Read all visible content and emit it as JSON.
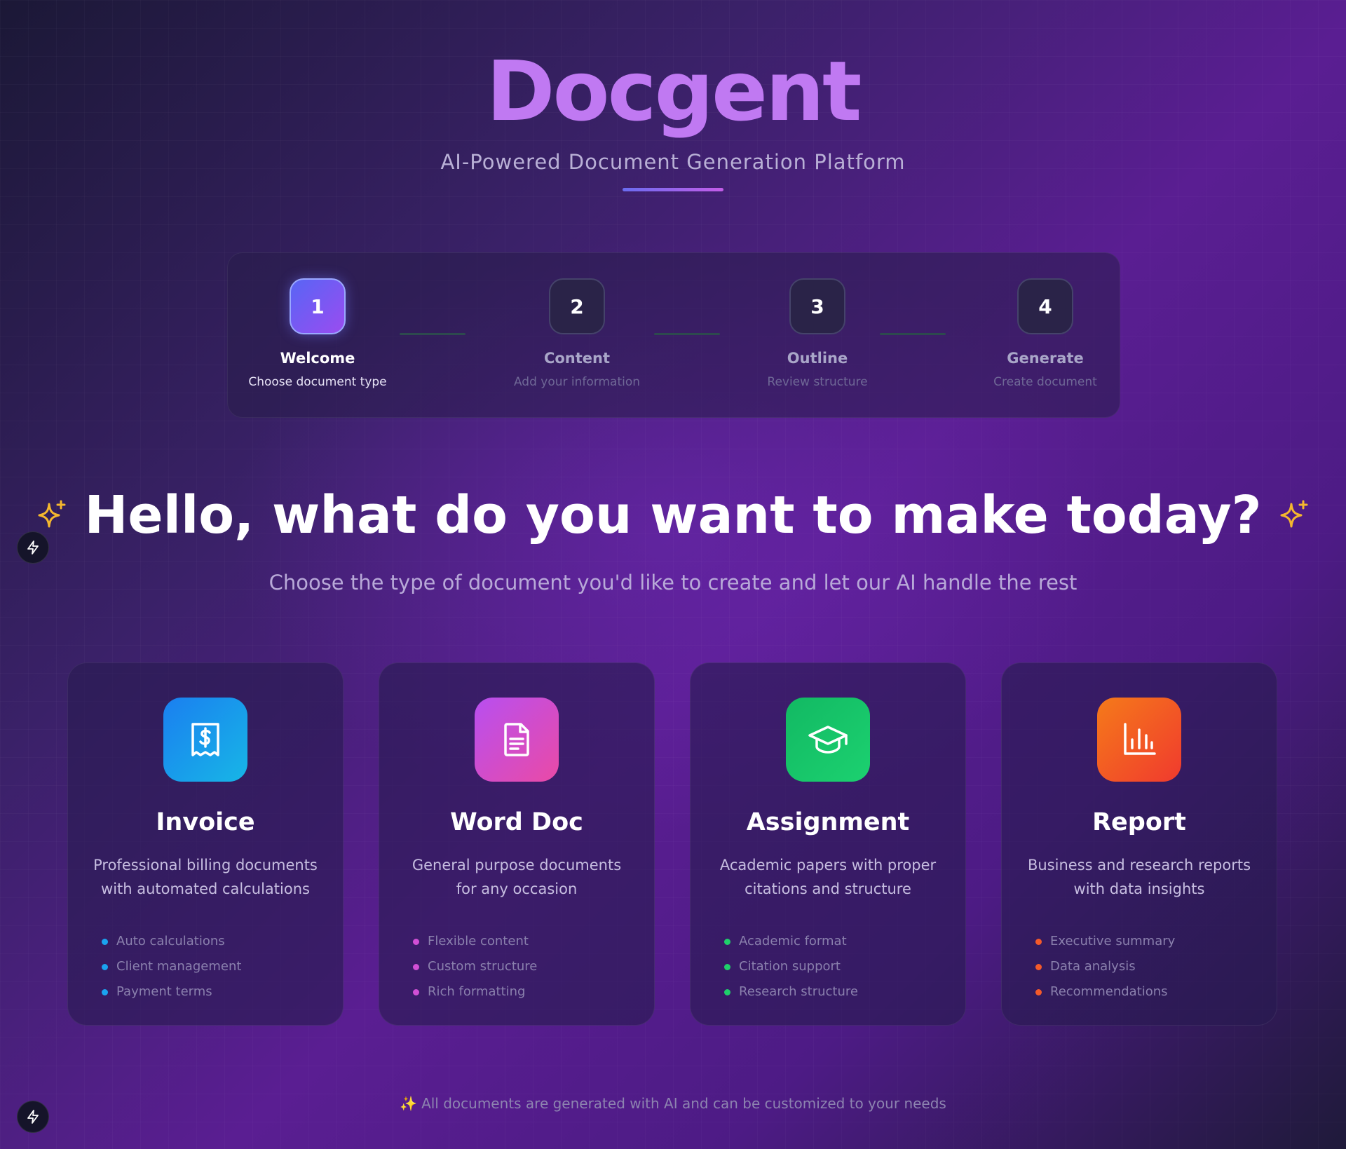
{
  "app": {
    "brand": "Docgent",
    "tagline": "AI-Powered Document Generation Platform"
  },
  "steps": [
    {
      "number": "1",
      "title": "Welcome",
      "subtitle": "Choose document type",
      "active": true
    },
    {
      "number": "2",
      "title": "Content",
      "subtitle": "Add your information",
      "active": false
    },
    {
      "number": "3",
      "title": "Outline",
      "subtitle": "Review structure",
      "active": false
    },
    {
      "number": "4",
      "title": "Generate",
      "subtitle": "Create document",
      "active": false
    }
  ],
  "hero": {
    "title": "Hello, what do you want to make today?",
    "subtitle": "Choose the type of document you'd like to create and let our AI handle the rest"
  },
  "cards": [
    {
      "icon": "receipt-dollar-icon",
      "accent": "#1aa3f0",
      "gradient": [
        "#1a7ff0",
        "#17b6e6"
      ],
      "title": "Invoice",
      "description": "Professional billing documents with automated calculations",
      "features": [
        "Auto calculations",
        "Client management",
        "Payment terms"
      ]
    },
    {
      "icon": "document-icon",
      "accent": "#d24fd6",
      "gradient": [
        "#b84ff0",
        "#ea4aa6"
      ],
      "title": "Word Doc",
      "description": "General purpose documents for any occasion",
      "features": [
        "Flexible content",
        "Custom structure",
        "Rich formatting"
      ]
    },
    {
      "icon": "graduation-cap-icon",
      "accent": "#1fcf6a",
      "gradient": [
        "#12b963",
        "#1cd170"
      ],
      "title": "Assignment",
      "description": "Academic papers with proper citations and structure",
      "features": [
        "Academic format",
        "Citation support",
        "Research structure"
      ]
    },
    {
      "icon": "bar-chart-icon",
      "accent": "#f45a2a",
      "gradient": [
        "#f57a1a",
        "#f03a2e"
      ],
      "title": "Report",
      "description": "Business and research reports with data insights",
      "features": [
        "Executive summary",
        "Data analysis",
        "Recommendations"
      ]
    }
  ],
  "footer": {
    "note": "All documents are generated with AI and can be customized to your needs"
  },
  "colors": {
    "brand": "#c079f2",
    "sparkle": "#f5b82e"
  }
}
